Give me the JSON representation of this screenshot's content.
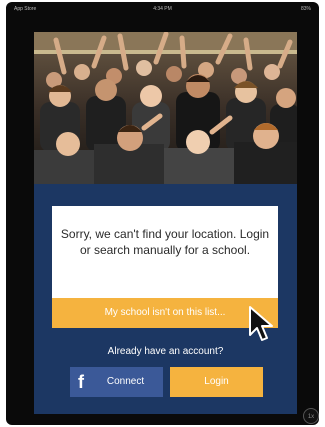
{
  "status_bar": {
    "left": "App Store",
    "time": "4:34 PM",
    "battery": "83%"
  },
  "hero": {
    "image": "cheering-student-crowd"
  },
  "message": {
    "text": "Sorry, we can't find your location. Login or search manually for a school."
  },
  "buttons": {
    "not_listed": "My school isn't on this list...",
    "connect": "Connect",
    "login": "Login"
  },
  "account": {
    "prompt": "Already have an account?"
  },
  "icons": {
    "facebook": "facebook-icon",
    "cursor": "pointer-cursor-icon"
  },
  "corner_badge": "1x",
  "colors": {
    "panel": "#1c3763",
    "accent": "#f5b33f",
    "facebook": "#3b5998"
  }
}
